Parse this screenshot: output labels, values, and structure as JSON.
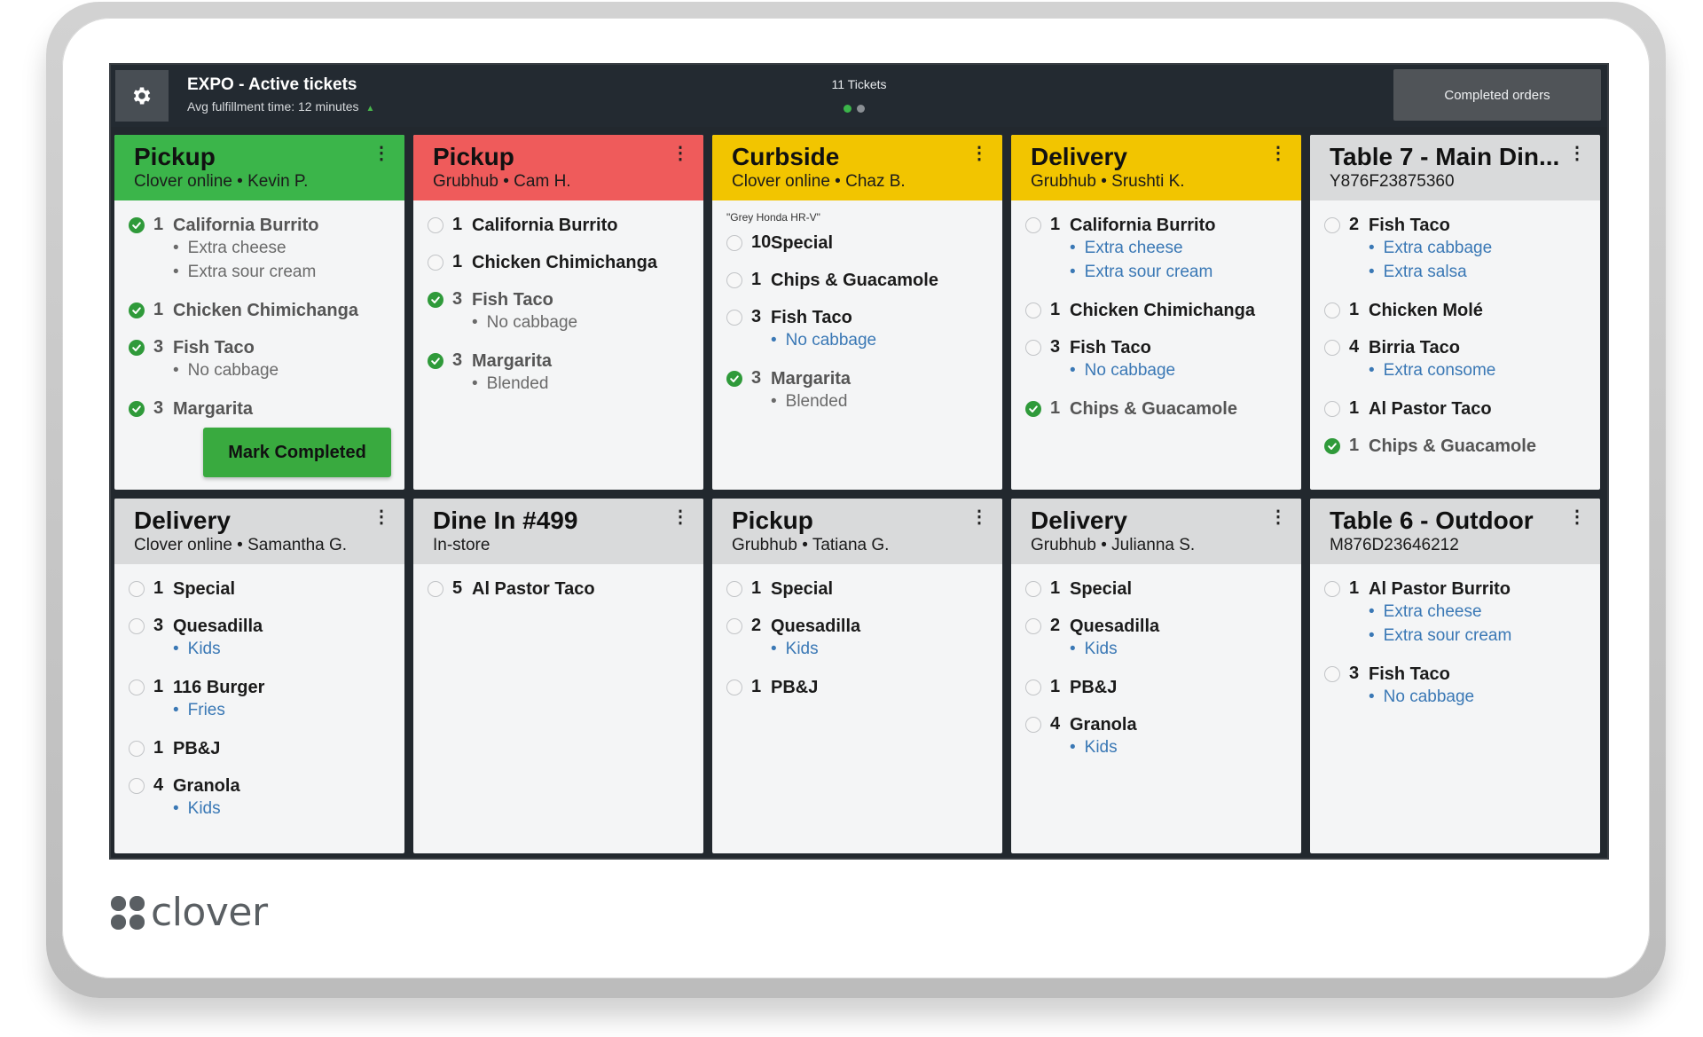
{
  "header": {
    "title": "EXPO - Active tickets",
    "subtitle": "Avg fulfillment time: 12 minutes",
    "ticket_count": "11 Tickets",
    "completed_button": "Completed orders"
  },
  "colors": {
    "green": "#3bb54a",
    "red": "#ef5b5b",
    "yellow": "#f2c500",
    "gray": "#d9dadb",
    "blue_modifier": "#3a78b5",
    "check_green": "#2f9a3a"
  },
  "tickets": [
    {
      "type": "Pickup",
      "source": "Clover online",
      "customer": "Kevin P.",
      "color": "green",
      "items": [
        {
          "qty": "1",
          "name": "California Burrito",
          "done": true,
          "modifiers": [
            "Extra cheese",
            "Extra sour cream"
          ],
          "mod_style": "gray"
        },
        {
          "qty": "1",
          "name": "Chicken Chimichanga",
          "done": true,
          "modifiers": []
        },
        {
          "qty": "3",
          "name": "Fish Taco",
          "done": true,
          "modifiers": [
            "No cabbage"
          ],
          "mod_style": "gray"
        },
        {
          "qty": "3",
          "name": "Margarita",
          "done": true,
          "modifiers": []
        }
      ],
      "action": "Mark Completed"
    },
    {
      "type": "Pickup",
      "source": "Grubhub",
      "customer": "Cam H.",
      "color": "red",
      "items": [
        {
          "qty": "1",
          "name": "California Burrito",
          "done": false,
          "modifiers": []
        },
        {
          "qty": "1",
          "name": "Chicken Chimichanga",
          "done": false,
          "modifiers": []
        },
        {
          "qty": "3",
          "name": "Fish Taco",
          "done": true,
          "modifiers": [
            "No cabbage"
          ],
          "mod_style": "gray"
        },
        {
          "qty": "3",
          "name": "Margarita",
          "done": true,
          "modifiers": [
            "Blended"
          ],
          "mod_style": "gray"
        }
      ]
    },
    {
      "type": "Curbside",
      "source": "Clover online",
      "customer": "Chaz B.",
      "color": "yellow",
      "note": "\"Grey Honda HR-V\"",
      "items": [
        {
          "qty": "10",
          "name": "Special",
          "done": false,
          "modifiers": []
        },
        {
          "qty": "1",
          "name": "Chips & Guacamole",
          "done": false,
          "modifiers": []
        },
        {
          "qty": "3",
          "name": "Fish Taco",
          "done": false,
          "modifiers": [
            "No cabbage"
          ],
          "mod_style": "blue"
        },
        {
          "qty": "3",
          "name": "Margarita",
          "done": true,
          "modifiers": [
            "Blended"
          ],
          "mod_style": "gray"
        }
      ]
    },
    {
      "type": "Delivery",
      "source": "Grubhub",
      "customer": "Srushti K.",
      "color": "yellow",
      "items": [
        {
          "qty": "1",
          "name": "California Burrito",
          "done": false,
          "modifiers": [
            "Extra cheese",
            "Extra sour cream"
          ],
          "mod_style": "blue"
        },
        {
          "qty": "1",
          "name": "Chicken Chimichanga",
          "done": false,
          "modifiers": []
        },
        {
          "qty": "3",
          "name": "Fish Taco",
          "done": false,
          "modifiers": [
            "No cabbage"
          ],
          "mod_style": "blue"
        },
        {
          "qty": "1",
          "name": "Chips & Guacamole",
          "done": true,
          "modifiers": []
        }
      ]
    },
    {
      "type": "Table 7 - Main Din...",
      "subline": "Y876F23875360",
      "color": "gray",
      "items": [
        {
          "qty": "2",
          "name": "Fish Taco",
          "done": false,
          "modifiers": [
            "Extra cabbage",
            "Extra salsa"
          ],
          "mod_style": "blue"
        },
        {
          "qty": "1",
          "name": "Chicken Molé",
          "done": false,
          "modifiers": []
        },
        {
          "qty": "4",
          "name": "Birria Taco",
          "done": false,
          "modifiers": [
            "Extra consome"
          ],
          "mod_style": "blue"
        },
        {
          "qty": "1",
          "name": "Al Pastor Taco",
          "done": false,
          "modifiers": []
        },
        {
          "qty": "1",
          "name": "Chips & Guacamole",
          "done": true,
          "modifiers": []
        }
      ]
    },
    {
      "type": "Delivery",
      "source": "Clover online",
      "customer": "Samantha G.",
      "color": "gray",
      "items": [
        {
          "qty": "1",
          "name": "Special",
          "done": false,
          "modifiers": []
        },
        {
          "qty": "3",
          "name": "Quesadilla",
          "done": false,
          "modifiers": [
            "Kids"
          ],
          "mod_style": "blue"
        },
        {
          "qty": "1",
          "name": "116 Burger",
          "done": false,
          "modifiers": [
            "Fries"
          ],
          "mod_style": "blue"
        },
        {
          "qty": "1",
          "name": "PB&J",
          "done": false,
          "modifiers": []
        },
        {
          "qty": "4",
          "name": "Granola",
          "done": false,
          "modifiers": [
            "Kids"
          ],
          "mod_style": "blue"
        }
      ]
    },
    {
      "type": "Dine In #499",
      "subline": "In-store",
      "color": "gray",
      "items": [
        {
          "qty": "5",
          "name": "Al Pastor Taco",
          "done": false,
          "modifiers": []
        }
      ]
    },
    {
      "type": "Pickup",
      "source": "Grubhub",
      "customer": "Tatiana G.",
      "color": "gray",
      "items": [
        {
          "qty": "1",
          "name": "Special",
          "done": false,
          "modifiers": []
        },
        {
          "qty": "2",
          "name": "Quesadilla",
          "done": false,
          "modifiers": [
            "Kids"
          ],
          "mod_style": "blue"
        },
        {
          "qty": "1",
          "name": "PB&J",
          "done": false,
          "modifiers": []
        }
      ]
    },
    {
      "type": "Delivery",
      "source": "Grubhub",
      "customer": "Julianna S.",
      "color": "gray",
      "items": [
        {
          "qty": "1",
          "name": "Special",
          "done": false,
          "modifiers": []
        },
        {
          "qty": "2",
          "name": "Quesadilla",
          "done": false,
          "modifiers": [
            "Kids"
          ],
          "mod_style": "blue"
        },
        {
          "qty": "1",
          "name": "PB&J",
          "done": false,
          "modifiers": []
        },
        {
          "qty": "4",
          "name": "Granola",
          "done": false,
          "modifiers": [
            "Kids"
          ],
          "mod_style": "blue"
        }
      ]
    },
    {
      "type": "Table 6 - Outdoor",
      "subline": "M876D23646212",
      "color": "gray",
      "items": [
        {
          "qty": "1",
          "name": "Al Pastor Burrito",
          "done": false,
          "modifiers": [
            "Extra cheese",
            "Extra sour cream"
          ],
          "mod_style": "blue"
        },
        {
          "qty": "3",
          "name": "Fish Taco",
          "done": false,
          "modifiers": [
            "No cabbage"
          ],
          "mod_style": "blue"
        }
      ]
    }
  ],
  "brand": {
    "logo_text": "clover"
  }
}
